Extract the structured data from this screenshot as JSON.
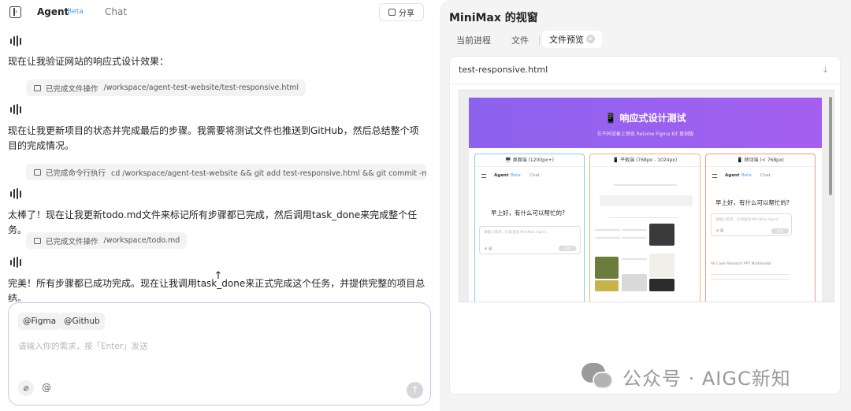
{
  "header": {
    "tab_agent": "Agent",
    "tab_agent_badge": "Beta",
    "tab_chat": "Chat",
    "share_label": "分享"
  },
  "conversation": [
    {
      "text": "现在让我验证网站的响应式设计效果：",
      "op_status": "已完成文件操作",
      "op_detail": "/workspace/agent-test-website/test-responsive.html"
    },
    {
      "text": "现在让我更新项目的状态并完成最后的步骤。我需要将测试文件也推送到GitHub，然后总结整个项目的完成情况。",
      "op_status": "已完成命令行执行",
      "op_detail": "cd /workspace/agent-test-website && git add test-responsive.html && git commit -m \"添..."
    },
    {
      "text": "太棒了！现在让我更新todo.md文件来标记所有步骤都已完成，然后调用task_done来完成整个任务。",
      "op_status": "已完成文件操作",
      "op_detail": "/workspace/todo.md"
    },
    {
      "text": "完美！所有步骤都已成功完成。现在让我调用task_done来正式完成这个任务，并提供完整的项目总结。"
    }
  ],
  "composer": {
    "mentions": [
      "@Figma",
      "@Github"
    ],
    "placeholder": "请输入你的需求，按「Enter」发送",
    "at_label": "@"
  },
  "panel": {
    "title": "MiniMax 的视窗",
    "tabs": [
      "当前进程",
      "文件",
      "文件预览"
    ],
    "active_tab": "文件预览",
    "file_name": "test-responsive.html"
  },
  "preview": {
    "hero_title": "📱 响应式设计测试",
    "hero_subtitle": "在不同设备上预览 Relume Figma Kit 复刻版",
    "devices": [
      {
        "label": "🖥️ 桌面端 (1200px+)"
      },
      {
        "label": "📱 平板端 (768px - 1024px)"
      },
      {
        "label": "📱 移动端 (< 768px)"
      }
    ],
    "mini_brand": "Agent",
    "mini_badge": "Beta",
    "mini_chat": "Chat",
    "greeting": "早上好，有什么可以帮忙的?",
    "mini_placeholder": "请输入需求，比如查询 MiniMax Agent",
    "mini_send": "发送",
    "mini_tabs": "All    Code    Research    PPT    Multimodal"
  },
  "watermark": {
    "text": "公众号 · AIGC新知"
  },
  "colors": {
    "accent_border": "#c9c6f2",
    "hero_gradient_start": "#8c62ee",
    "hero_gradient_end": "#a55ff0",
    "beta_blue": "#4a9cf0"
  }
}
